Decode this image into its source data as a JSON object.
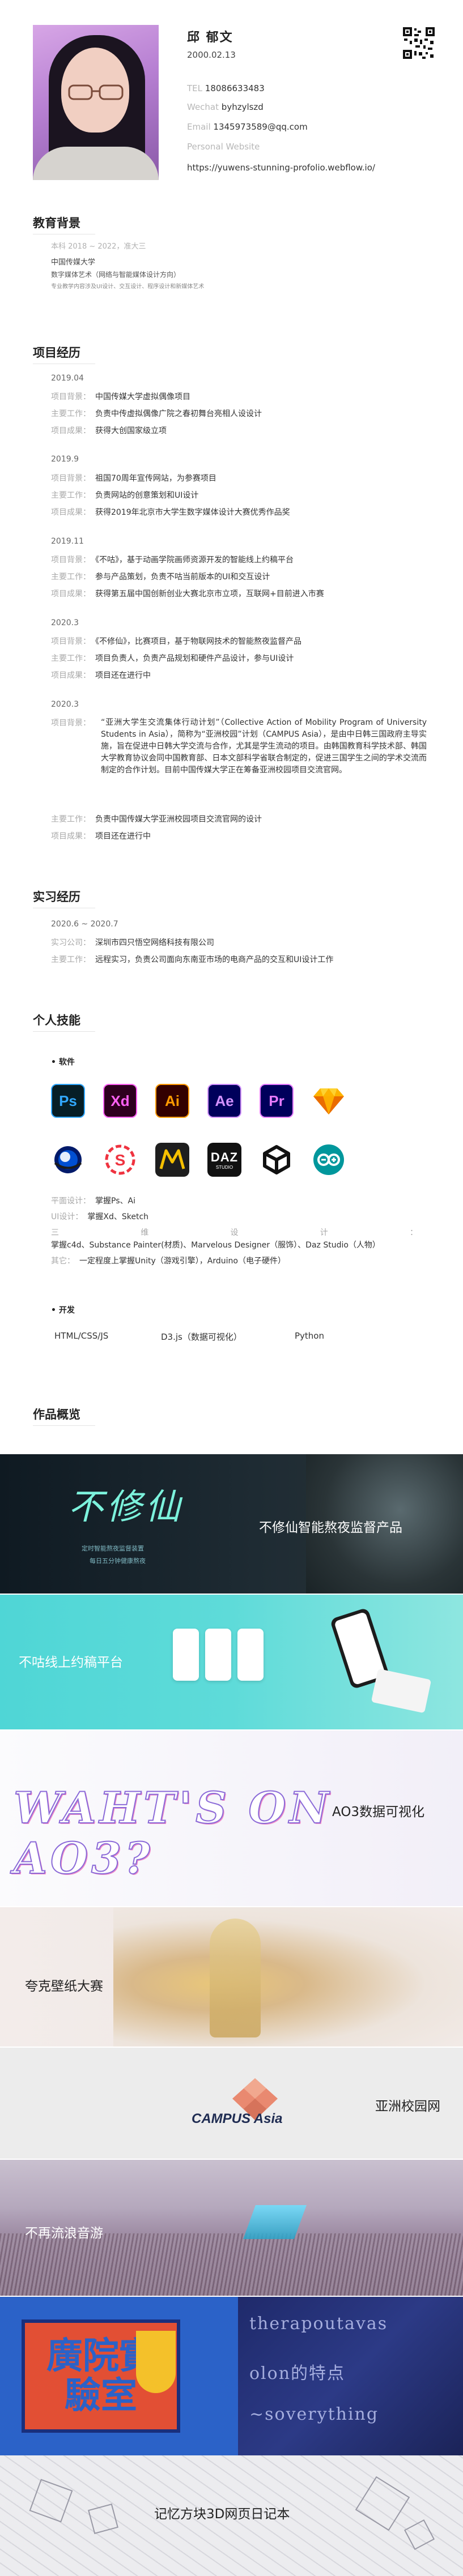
{
  "profile": {
    "name": "邱 郁文",
    "dob": "2000.02.13",
    "tel_label": "TEL",
    "tel": "18086633483",
    "wechat_label": "Wechat",
    "wechat": "byhzylszd",
    "email_label": "Email",
    "email": "1345973589@qq.com",
    "website_label": "Personal Website",
    "website": "https://yuwens-stunning-profolio.webflow.io/"
  },
  "education": {
    "title": "教育背景",
    "period": "本科 2018 ~ 2022，准大三",
    "school": "中国传媒大学",
    "major": "数字媒体艺术（网络与智能媒体设计方向）",
    "courses": "专业教学内容涉及UI设计、交互设计、程序设计和新媒体艺术"
  },
  "projects": {
    "title": "项目经历",
    "labels": {
      "background": "项目背景：",
      "work": "主要工作：",
      "result": "项目成果："
    },
    "items": [
      {
        "date": "2019.04",
        "background": "中国传媒大学虚拟偶像项目",
        "work": "负责中传虚拟偶像广院之春初舞台亮相人设设计",
        "result": "获得大创国家级立项"
      },
      {
        "date": "2019.9",
        "background": "祖国70周年宣传网站，为参赛项目",
        "work": "负责网站的创意策划和UI设计",
        "result": "获得2019年北京市大学生数字媒体设计大赛优秀作品奖"
      },
      {
        "date": "2019.11",
        "background": "《不咕》，基于动画学院画师资源开发的智能线上约稿平台",
        "work": "参与产品策划，负责不咕当前版本的UI和交互设计",
        "result": "获得第五届中国创新创业大赛北京市立项，互联网+目前进入市赛"
      },
      {
        "date": "2020.3",
        "background": "《不修仙》，比赛项目，基于物联网技术的智能熬夜监督产品",
        "work": "项目负责人，负责产品规划和硬件产品设计，参与UI设计",
        "result": "项目还在进行中"
      },
      {
        "date": "2020.3",
        "background": "“亚洲大学生交流集体行动计划”（Collective Action of Mobility Program of University Students in Asia），简称为“亚洲校园”计划（CAMPUS Asia），是由中日韩三国政府主导实施，旨在促进中日韩大学交流与合作，尤其是学生流动的项目。由韩国教育科学技术部、韩国大学教育协议会同中国教育部、日本文部科学省联合制定的，促进三国学生之间的学术交流而制定的合作计划。目前中国传媒大学正在筹备亚洲校园项目交流官网。",
        "work": "负责中国传媒大学亚洲校园项目交流官网的设计",
        "result": "项目还在进行中"
      }
    ]
  },
  "internship": {
    "title": "实习经历",
    "period": "2020.6 ~ 2020.7",
    "company_label": "实习公司：",
    "company": "深圳市四只悟空网络科技有限公司",
    "work_label": "主要工作：",
    "work": "远程实习，负责公司面向东南亚市场的电商产品的交互和UI设计工作"
  },
  "skills": {
    "title": "个人技能",
    "software_heading": "• 软件",
    "icons_row1": [
      {
        "glyph": "Ps",
        "name": "photoshop-icon",
        "bg": "#061e26",
        "fg": "#31a8ff"
      },
      {
        "glyph": "Xd",
        "name": "xd-icon",
        "bg": "#2e001f",
        "fg": "#ff61f6"
      },
      {
        "glyph": "Ai",
        "name": "illustrator-icon",
        "bg": "#330000",
        "fg": "#ff9a00"
      },
      {
        "glyph": "Ae",
        "name": "after-effects-icon",
        "bg": "#00005b",
        "fg": "#d291ff"
      },
      {
        "glyph": "Pr",
        "name": "premiere-icon",
        "bg": "#00005b",
        "fg": "#e77bff"
      },
      {
        "glyph": "◆",
        "name": "sketch-icon",
        "bg": "#ffffff",
        "fg": "#f7b500"
      }
    ],
    "icons_row2": [
      {
        "glyph": "C4D",
        "name": "cinema4d-icon"
      },
      {
        "glyph": "S",
        "name": "substance-painter-icon"
      },
      {
        "glyph": "M",
        "name": "marvelous-designer-icon"
      },
      {
        "glyph": "DAZ",
        "name": "daz-studio-icon"
      },
      {
        "glyph": "U",
        "name": "unity-icon"
      },
      {
        "glyph": "∞",
        "name": "arduino-icon"
      }
    ],
    "lines": [
      {
        "k": "平面设计：",
        "v": "掌握Ps、Ai"
      },
      {
        "k": "UI设计：",
        "v": "掌握Xd、Sketch"
      },
      {
        "k": "三维设计：",
        "v": "掌握c4d、Substance Painter(材质)、Marvelous Designer（服饰）、Daz Studio（人物）"
      },
      {
        "k": "其它：",
        "v": "一定程度上掌握Unity（游戏引擎），Arduino（电子硬件）"
      }
    ],
    "dev_heading": "• 开发",
    "dev": [
      "HTML/CSS/JS",
      "D3.js（数据可视化）",
      "Python"
    ]
  },
  "works": {
    "title": "作品概览",
    "banners": [
      {
        "caption": "不修仙智能熬夜监督产品",
        "art": "不修仙",
        "sub1": "定时智能熬夜监督装置",
        "sub2": "每日五分钟健康熬夜"
      },
      {
        "caption": "不咕线上约稿平台"
      },
      {
        "caption": "AO3数据可视化",
        "art": "WAHT'S ON AO3?"
      },
      {
        "caption": "夸克壁纸大赛"
      },
      {
        "caption": "亚洲校园网",
        "logo": "CAMPUS Asia"
      },
      {
        "caption": "不再流浪音游"
      },
      {
        "caption": "记忆方块3D网页日记本",
        "poster": "廣院實驗室"
      }
    ]
  }
}
